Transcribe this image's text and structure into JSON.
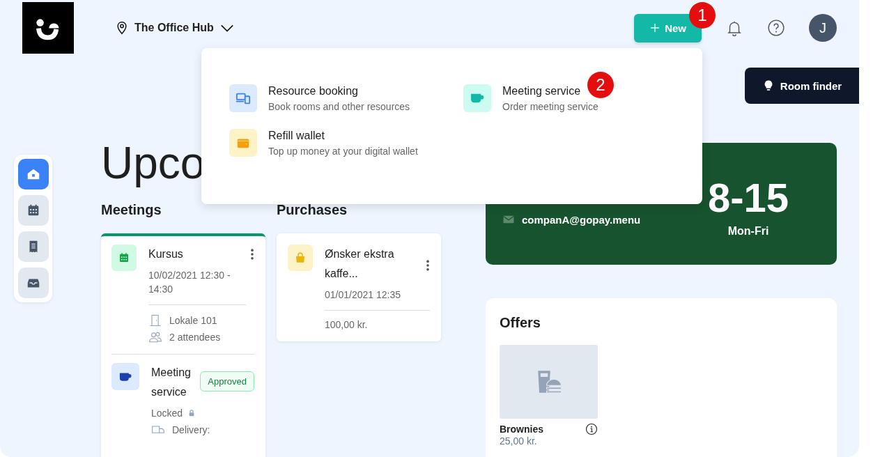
{
  "header": {
    "location": "The Office Hub",
    "new_button": "New",
    "avatar_initial": "J"
  },
  "markers": [
    "1",
    "2"
  ],
  "room_finder": "Room finder",
  "sidebar": {
    "items": [
      {
        "selected": true
      },
      {
        "selected": false
      },
      {
        "selected": false
      },
      {
        "selected": false
      }
    ]
  },
  "heading": "Upco",
  "meetings": {
    "title": "Meetings",
    "items": [
      {
        "kind": "booking",
        "title": "Kursus",
        "time": "10/02/2021 12:30 - 14:30",
        "room": "Lokale 101",
        "attendees": "2 attendees"
      },
      {
        "kind": "service",
        "title": "Meeting service",
        "status": "Approved",
        "lock": "Locked",
        "delivery": "Delivery:"
      }
    ]
  },
  "purchases": {
    "title": "Purchases",
    "items": [
      {
        "title": "Ønsker ekstra kaffe...",
        "time": "01/01/2021 12:35",
        "price": "100,00 kr."
      }
    ]
  },
  "contact": {
    "email": "companA@gopay.menu",
    "hours": "8-15",
    "days": "Mon-Fri"
  },
  "offers": {
    "title": "Offers",
    "items": [
      {
        "name": "Brownies",
        "price": "25,00 kr."
      }
    ]
  },
  "menu": {
    "items": [
      {
        "kind": "resource",
        "title": "Resource booking",
        "subtitle": "Book rooms and other resources"
      },
      {
        "kind": "service",
        "title": "Meeting service",
        "subtitle": "Order meeting service"
      },
      {
        "kind": "wallet",
        "title": "Refill wallet",
        "subtitle": "Top up money at your digital wallet"
      }
    ]
  }
}
